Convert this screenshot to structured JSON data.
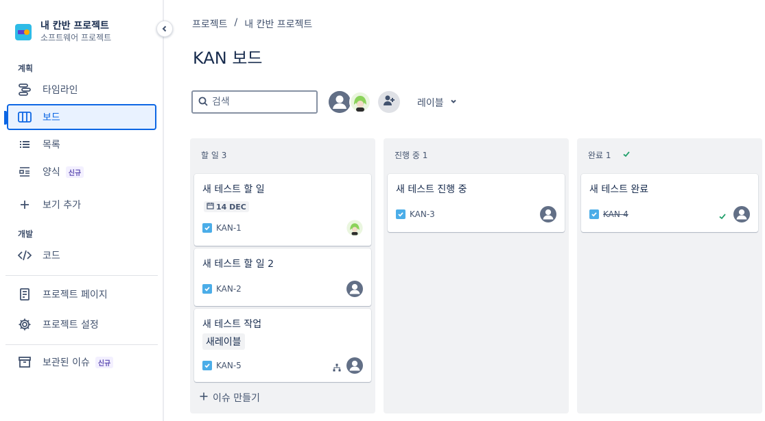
{
  "project": {
    "name": "내 칸반 프로젝트",
    "type": "소프트웨어 프로젝트"
  },
  "sidebar": {
    "section_plan": "계획",
    "section_dev": "개발",
    "items": [
      {
        "label": "타임라인",
        "icon": "timeline-icon"
      },
      {
        "label": "보드",
        "icon": "board-icon",
        "active": true
      },
      {
        "label": "목록",
        "icon": "list-icon"
      },
      {
        "label": "양식",
        "icon": "form-icon",
        "badge": "신규"
      },
      {
        "label": "보기 추가",
        "icon": "plus-icon"
      },
      {
        "label": "코드",
        "icon": "code-icon"
      },
      {
        "label": "프로젝트 페이지",
        "icon": "page-icon"
      },
      {
        "label": "프로젝트 설정",
        "icon": "gear-icon"
      },
      {
        "label": "보관된 이슈",
        "icon": "archive-icon",
        "badge": "신규"
      }
    ]
  },
  "breadcrumb": {
    "root": "프로젝트",
    "sep": "/",
    "current": "내 칸반 프로젝트"
  },
  "page_title": "KAN 보드",
  "toolbar": {
    "search_placeholder": "검색",
    "label_filter": "레이블"
  },
  "columns": [
    {
      "title": "할 일 3",
      "cards": [
        {
          "title": "새 테스트 할 일",
          "due": "14 DEC",
          "key": "KAN-1",
          "assignee": "avatar-photo"
        },
        {
          "title": "새 테스트 할 일 2",
          "key": "KAN-2",
          "assignee": "avatar-default"
        },
        {
          "title": "새 테스트 작업",
          "label": "새레이블",
          "key": "KAN-5",
          "assignee": "avatar-default"
        }
      ],
      "create_label": "이슈 만들기"
    },
    {
      "title": "진행 중 1",
      "cards": [
        {
          "title": "새 테스트 진행 중",
          "key": "KAN-3",
          "assignee": "avatar-default"
        }
      ]
    },
    {
      "title": "완료 1",
      "cards": [
        {
          "title": "새 테스트 완료",
          "key": "KAN-4",
          "assignee": "avatar-default",
          "done": true
        }
      ]
    }
  ],
  "colors": {
    "accent": "#0c66e4",
    "task_icon": "#4bade8",
    "done_green": "#22a06b",
    "column_bg": "#f1f2f4"
  }
}
